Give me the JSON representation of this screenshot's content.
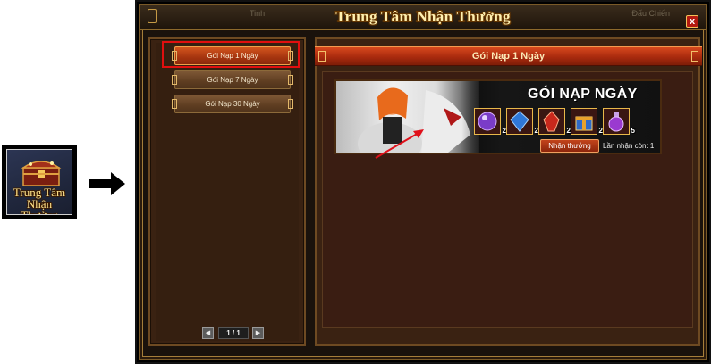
{
  "launcher": {
    "label_line1": "Trung Tâm",
    "label_line2": "Nhận Thưởng",
    "icon": "treasure-chest-icon"
  },
  "arrow_icon": "arrow-right-icon",
  "window": {
    "title": "Trung Tâm Nhận Thưởng",
    "background_texts": [
      "Tinh",
      "Đấu Chiến"
    ],
    "close_label": "x"
  },
  "tabs": [
    {
      "label": "Gói Nạp 1 Ngày",
      "active": true
    },
    {
      "label": "Gói Nạp 7 Ngày",
      "active": false
    },
    {
      "label": "Gói Nạp 30 Ngày",
      "active": false
    }
  ],
  "pager": {
    "prev_icon": "◀",
    "next_icon": "▶",
    "page_text": "1 / 1"
  },
  "content": {
    "header_title": "Gói Nạp 1 Ngày",
    "pack_title": "GÓI NẠP NGÀY",
    "items": [
      {
        "icon": "purple-orb-icon",
        "qty": "2",
        "color": "#7a3cc8"
      },
      {
        "icon": "blue-crystal-icon",
        "qty": "2",
        "color": "#2f78d8"
      },
      {
        "icon": "red-crystal-icon",
        "qty": "2",
        "color": "#c8281c"
      },
      {
        "icon": "gift-box-icon",
        "qty": "2",
        "color": "#e8a22c"
      },
      {
        "icon": "potion-bottle-icon",
        "qty": "5",
        "color": "#9a3ad0"
      }
    ],
    "claim_button": "Nhận thưởng",
    "remaining_text": "Lần nhận còn: 1"
  },
  "colors": {
    "accent_red": "#c2441c",
    "highlight_box": "#e10f0f",
    "gold": "#e8b84a"
  }
}
